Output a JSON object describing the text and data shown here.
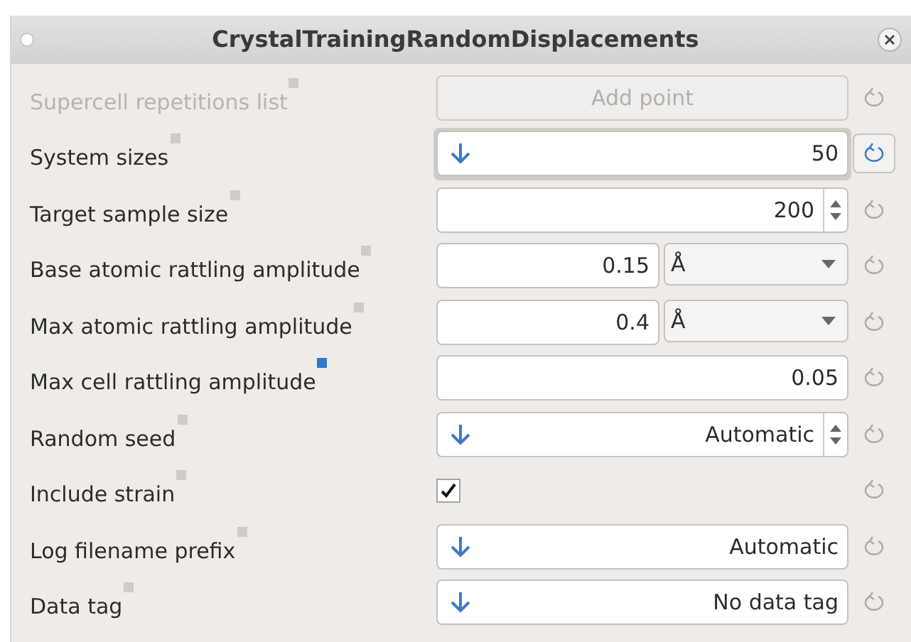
{
  "window": {
    "title": "CrystalTrainingRandomDisplacements"
  },
  "rows": [
    {
      "kind": "button",
      "label": "Supercell repetitions list",
      "value": "Add point",
      "disabled": true,
      "help_highlighted": false,
      "focused": false,
      "reset_active": false
    },
    {
      "kind": "arrow-input",
      "label": "System sizes",
      "value": "50",
      "disabled": false,
      "help_highlighted": false,
      "focused": true,
      "reset_active": true
    },
    {
      "kind": "spin",
      "label": "Target sample size",
      "value": "200",
      "disabled": false,
      "help_highlighted": false,
      "focused": false,
      "reset_active": false
    },
    {
      "kind": "unit",
      "label": "Base atomic rattling amplitude",
      "value": "0.15",
      "unit": "Å",
      "disabled": false,
      "help_highlighted": false,
      "focused": false,
      "reset_active": false
    },
    {
      "kind": "unit",
      "label": "Max atomic rattling amplitude",
      "value": "0.4",
      "unit": "Å",
      "disabled": false,
      "help_highlighted": false,
      "focused": false,
      "reset_active": false
    },
    {
      "kind": "input",
      "label": "Max cell rattling amplitude",
      "value": "0.05",
      "disabled": false,
      "help_highlighted": true,
      "focused": false,
      "reset_active": false
    },
    {
      "kind": "arrow-spin",
      "label": "Random seed",
      "value": "Automatic",
      "disabled": false,
      "help_highlighted": false,
      "focused": false,
      "reset_active": false
    },
    {
      "kind": "checkbox",
      "label": "Include strain",
      "checked": true,
      "disabled": false,
      "help_highlighted": false,
      "focused": false,
      "reset_active": false
    },
    {
      "kind": "arrow-input",
      "label": "Log filename prefix",
      "value": "Automatic",
      "disabled": false,
      "help_highlighted": false,
      "focused": false,
      "reset_active": false
    },
    {
      "kind": "arrow-input",
      "label": "Data tag",
      "value": "No data tag",
      "disabled": false,
      "help_highlighted": false,
      "focused": false,
      "reset_active": false
    }
  ]
}
